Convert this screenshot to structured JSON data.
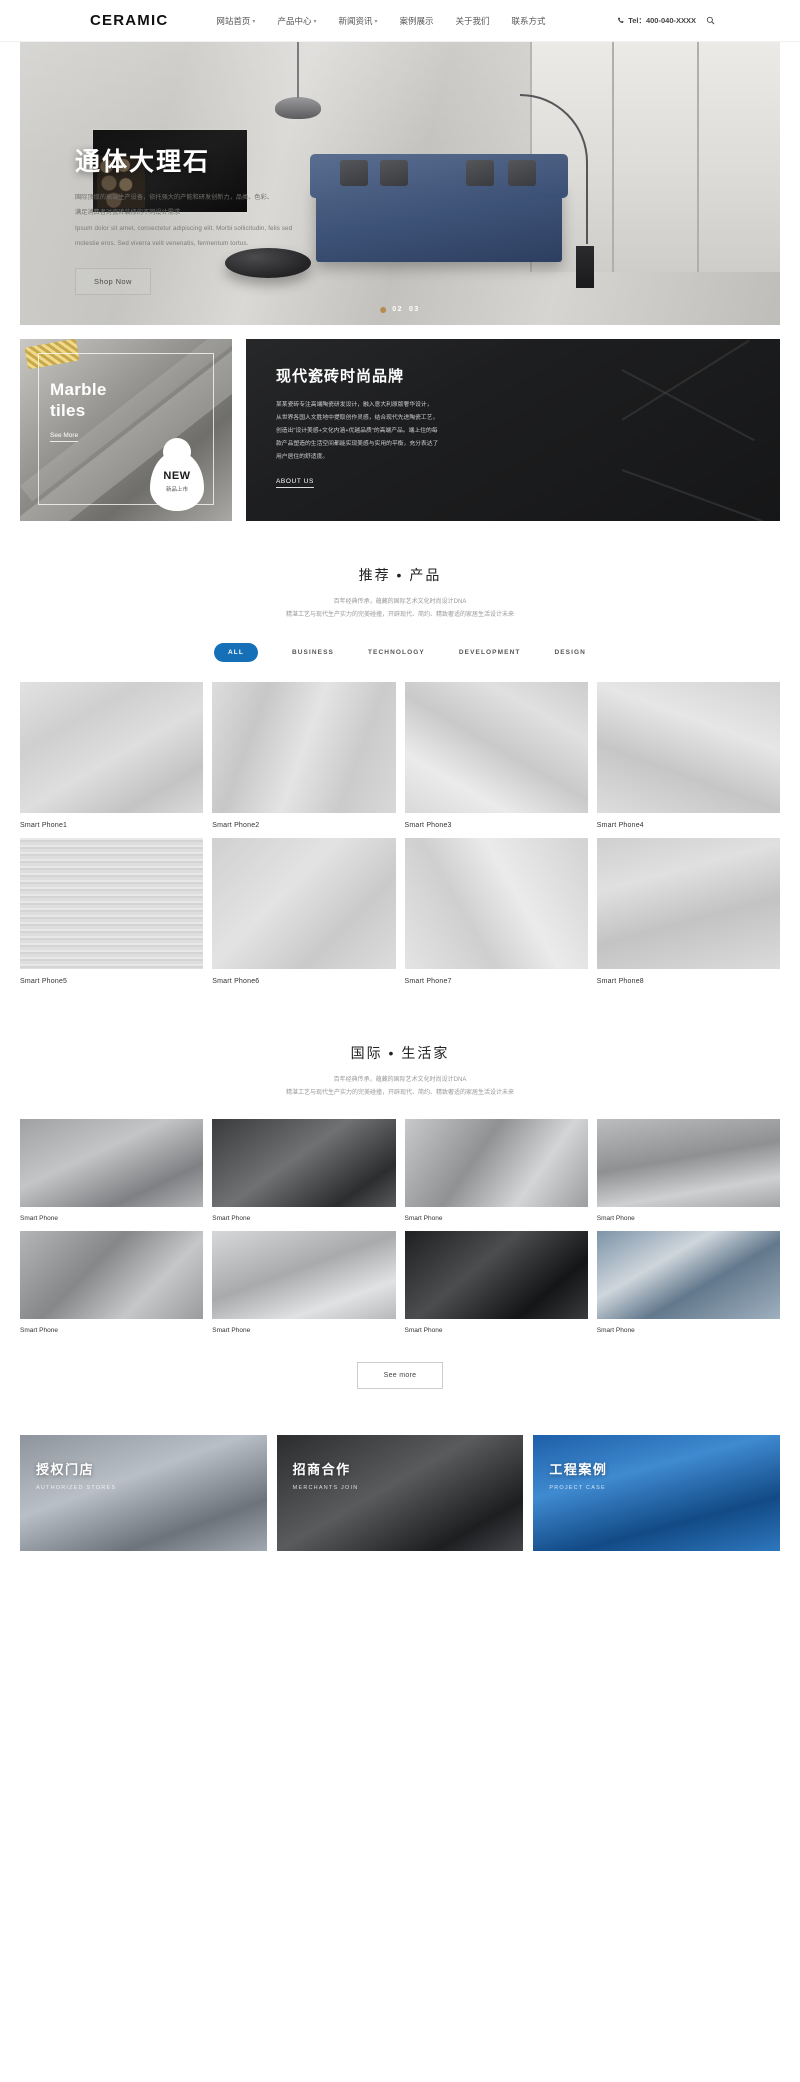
{
  "header": {
    "logo": "CERAMIC",
    "nav": [
      {
        "label": "网站首页",
        "caret": "▾"
      },
      {
        "label": "产品中心",
        "caret": "▾"
      },
      {
        "label": "新闻资讯",
        "caret": "▾"
      },
      {
        "label": "案例展示",
        "caret": ""
      },
      {
        "label": "关于我们",
        "caret": ""
      },
      {
        "label": "联系方式",
        "caret": ""
      }
    ],
    "tel": "Tel：400-040-XXXX",
    "search_icon": "search-icon",
    "phone_icon": "phone-icon"
  },
  "hero": {
    "title": "通体大理石",
    "desc_cn_1": "国际顶级的高端生产设备，依托强大的产能和研发创新力，品类、色彩、",
    "desc_cn_2": "满足消费者对瓷砖装修的不同设计需求",
    "desc_en_1": "Ipsum dolor sit amet, consectetur adipiscing elit. Morbi sollicitudin, felis sed",
    "desc_en_2": "molestie eros. Sed viverra velit venenatis, fermentum tortus.",
    "button": "Shop Now",
    "pager_current": "02",
    "pager_total": "03"
  },
  "promo_left": {
    "title_line1": "Marble",
    "title_line2": "tiles",
    "more": "See More",
    "badge": "NEW",
    "badge_sub": "新品上市"
  },
  "promo_right": {
    "title": "现代瓷砖时尚品牌",
    "desc": [
      "某某瓷砖专注高端陶瓷研发设计，融入意大利原版奢华设计，",
      "从世界各国人文胜地中提取创作灵感，结合现代先进陶瓷工艺，",
      "创造出\"设计美感+文化内涵+优越品质\"的高端产品。端上住的每",
      "款产品塑造的生活空间都能实现美感与实用的平衡，充分表达了",
      "用户居住的舒适度。"
    ],
    "link": "ABOUT US"
  },
  "products_section": {
    "title": "推荐 • 产品",
    "sub_line1": "百年经典传承，蕴藏的国际艺术文化时尚设计DNA",
    "sub_line2": "精湛工艺与现代生产实力的完美碰撞，开辟现代、简约、精致奢适的家居生活设计未来",
    "filters": [
      {
        "label": "ALL",
        "active": true
      },
      {
        "label": "BUSINESS",
        "active": false
      },
      {
        "label": "TECHNOLOGY",
        "active": false
      },
      {
        "label": "DEVELOPMENT",
        "active": false
      },
      {
        "label": "DESIGN",
        "active": false
      }
    ],
    "items": [
      {
        "label": "Smart Phone1"
      },
      {
        "label": "Smart Phone2"
      },
      {
        "label": "Smart Phone3"
      },
      {
        "label": "Smart Phone4"
      },
      {
        "label": "Smart Phone5"
      },
      {
        "label": "Smart Phone6"
      },
      {
        "label": "Smart Phone7"
      },
      {
        "label": "Smart Phone8"
      }
    ]
  },
  "life_section": {
    "title": "国际 • 生活家",
    "sub_line1": "百年经典传承，蕴藏的国际艺术文化时尚设计DNA",
    "sub_line2": "精湛工艺与现代生产实力的完美碰撞，开辟现代、简约、精致奢适的家居生活设计未来",
    "items": [
      {
        "label": "Smart Phone"
      },
      {
        "label": "Smart Phone"
      },
      {
        "label": "Smart Phone"
      },
      {
        "label": "Smart Phone"
      },
      {
        "label": "Smart Phone"
      },
      {
        "label": "Smart Phone"
      },
      {
        "label": "Smart Phone"
      },
      {
        "label": "Smart Phone"
      }
    ],
    "see_more": "See more"
  },
  "banners": [
    {
      "title": "授权门店",
      "sub": "AUTHORIZED STORES"
    },
    {
      "title": "招商合作",
      "sub": "MERCHANTS JOIN"
    },
    {
      "title": "工程案例",
      "sub": "PROJECT CASE"
    }
  ],
  "colors": {
    "accent_blue": "#1570b8",
    "pager_dot": "#b78b4e",
    "dark_panel": "#0c0c0c"
  }
}
